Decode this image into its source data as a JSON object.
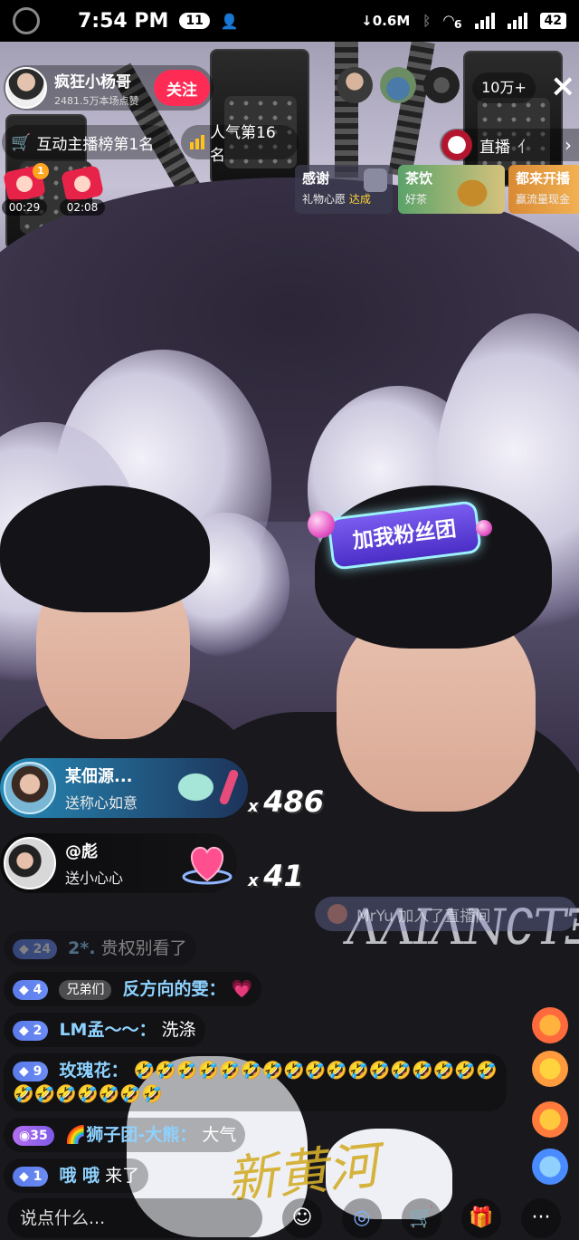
{
  "status_bar": {
    "time": "7:54 PM",
    "notification_count": "11",
    "network_speed": "0.6M",
    "battery": "42",
    "wifi_sub": "6",
    "sim_sub": "2"
  },
  "host": {
    "name": "疯狂小杨哥",
    "likes": "2481.5万本场点赞",
    "follow_label": "关注"
  },
  "viewers": {
    "count": "10万+",
    "close_icon": "×"
  },
  "rankings": {
    "interactive_rank": "互动主播榜第1名",
    "popularity_rank": "人气第16名"
  },
  "red_packets": [
    {
      "timer": "00:29",
      "badge": "1"
    },
    {
      "timer": "02:08"
    }
  ],
  "live_chip": {
    "label": "直播",
    "extra": "亻"
  },
  "banners": {
    "thanks": {
      "title": "感谢",
      "sub_prefix": "礼物心愿",
      "sub_status": "达成"
    },
    "tea": {
      "title": "茶饮",
      "sub": "好茶"
    },
    "promo": {
      "title": "都来开播",
      "sub": "赢流量现金"
    }
  },
  "fan_club_bubble": "加我粉丝团",
  "gifts": [
    {
      "sender": "某佃源...",
      "desc": "送称心如意",
      "combo": "486",
      "icon": "jade-ruyi-icon"
    },
    {
      "sender": "@彪",
      "desc": "送小心心",
      "combo": "41",
      "icon": "heart-icon"
    }
  ],
  "combo_prefix": "x",
  "join_notice": "MrYu 加入了直播间",
  "chat": [
    {
      "level": "24",
      "user": "2*.",
      "text": "贵权别看了",
      "faded": true
    },
    {
      "level": "4",
      "fan_tag": "兄弟们",
      "user": "反方向的雯",
      "sep": "：",
      "text": "",
      "emoji": "💗"
    },
    {
      "level": "2",
      "user": "LM孟～～",
      "sep": "：",
      "text": "洗涤"
    },
    {
      "level": "9",
      "user": "玫瑰花",
      "sep": "：",
      "text": "",
      "emoji": "🤣🤣🤣🤣🤣🤣🤣🤣🤣🤣🤣🤣🤣🤣🤣🤣🤣🤣🤣🤣🤣🤣🤣🤣"
    },
    {
      "level": "35",
      "user": "🌈狮子团-大熊",
      "sep": "：",
      "text": "大气"
    },
    {
      "level": "1",
      "user": "哦 哦",
      "sep": "",
      "text": "来了"
    }
  ],
  "bottom_bar": {
    "placeholder": "说点什么...",
    "more": "···"
  },
  "watermark": "新黄河",
  "colors": {
    "follow": "#fe2c55",
    "accent_yellow": "#ffc21a",
    "username_blue": "#8ed2ff",
    "level_badge": "#5a7be8"
  }
}
